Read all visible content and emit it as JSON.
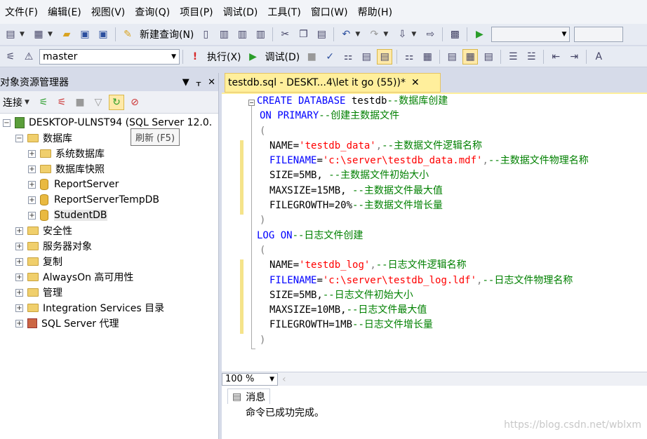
{
  "menu": [
    "文件(F)",
    "编辑(E)",
    "视图(V)",
    "查询(Q)",
    "项目(P)",
    "调试(D)",
    "工具(T)",
    "窗口(W)",
    "帮助(H)"
  ],
  "toolbar1": {
    "new_query_label": "新建查询(N)"
  },
  "toolbar2": {
    "database_combo_value": "master",
    "execute_label": "执行(X)",
    "debug_label": "调试(D)"
  },
  "object_explorer": {
    "title": "对象资源管理器",
    "connect_label": "连接",
    "tooltip": "刷新 (F5)",
    "tree": {
      "server": "DESKTOP-ULNST94 (SQL Server 12.0.",
      "databases": "数据库",
      "system_databases": "系统数据库",
      "database_snapshots": "数据库快照",
      "db_reportserver": "ReportServer",
      "db_reportservertempdb": "ReportServerTempDB",
      "db_studentdb": "StudentDB",
      "security": "安全性",
      "server_objects": "服务器对象",
      "replication": "复制",
      "alwayson": "AlwaysOn 高可用性",
      "management": "管理",
      "integration_services": "Integration Services 目录",
      "sql_agent": "SQL Server 代理"
    }
  },
  "editor": {
    "tab_title": "testdb.sql - DESKT...4\\let  it  go (55))*",
    "lines": [
      {
        "kw": "CREATE DATABASE",
        "tx": " testdb",
        "cm": "--数据库创建"
      },
      {
        "kw": "ON PRIMARY",
        "cm": "--创建主数据文件"
      },
      {
        "gr": "("
      },
      {
        "tx": "NAME=",
        "st": "'testdb_data'",
        "gr": ",",
        "cm": "--主数据文件逻辑名称"
      },
      {
        "kw": "FILENAME",
        "tx": "=",
        "st": "'c:\\server\\testdb_data.mdf'",
        "gr": ",",
        "cm": "--主数据文件物理名称"
      },
      {
        "tx": "SIZE=5MB, ",
        "cm": "--主数据文件初始大小"
      },
      {
        "tx": "MAXSIZE=15MB, ",
        "cm": "--主数据文件最大值"
      },
      {
        "tx": "FILEGROWTH=20%",
        "cm": "--主数据文件增长量"
      },
      {
        "gr": ")"
      },
      {
        "kw": "LOG ON",
        "cm": "--日志文件创建"
      },
      {
        "gr": "("
      },
      {
        "tx": "NAME=",
        "st": "'testdb_log'",
        "gr": ",",
        "cm": "--日志文件逻辑名称"
      },
      {
        "kw": "FILENAME",
        "tx": "=",
        "st": "'c:\\server\\testdb_log.ldf'",
        "gr": ",",
        "cm": "--日志文件物理名称"
      },
      {
        "tx": "SIZE=5MB,",
        "cm": "--日志文件初始大小"
      },
      {
        "tx": "MAXSIZE=10MB,",
        "cm": "--日志文件最大值"
      },
      {
        "tx": "FILEGROWTH=1MB",
        "cm": "--日志文件增长量"
      },
      {
        "gr": ")"
      }
    ],
    "zoom": "100 %"
  },
  "messages": {
    "tab_label": "消息",
    "text": "命令已成功完成。"
  },
  "watermark": "https://blog.csdn.net/wblxm",
  "colors": {
    "keyword": "#0000ff",
    "comment": "#008000",
    "string": "#ff0000",
    "tab_active": "#ffef9c"
  }
}
